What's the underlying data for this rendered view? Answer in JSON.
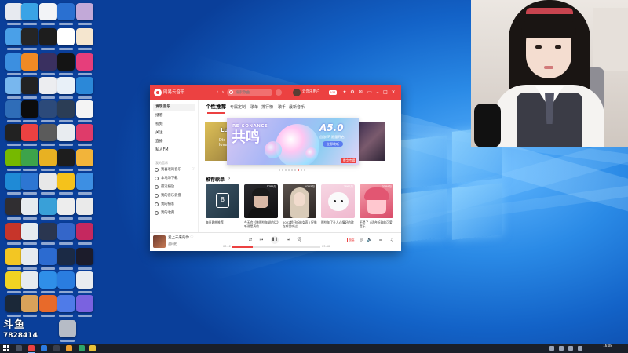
{
  "app": {
    "title": "网易云音乐",
    "search_placeholder": "搜索歌曲",
    "username": "云音乐用户",
    "vip_badge": "VIP",
    "tabs": [
      "个性推荐",
      "专属定制",
      "歌单",
      "排行榜",
      "歌手",
      "最新音乐"
    ],
    "sidebar": {
      "items": [
        "发现音乐",
        "播客",
        "视频",
        "关注",
        "直播",
        "私人FM"
      ],
      "section_label": "我的音乐",
      "sub_items": [
        "我喜欢的音乐",
        "本地与下载",
        "最近播放",
        "我的音乐云盘",
        "我的播客",
        "我的收藏"
      ]
    },
    "banner": {
      "left_title": "Lo",
      "left_sub": "Did you\nlove",
      "title": "RE-SONANCE",
      "cjk": "共鸣",
      "logo": "A5.0",
      "album_line": "首张EP 限量开启",
      "button": "立即收听",
      "tag": "数字专辑",
      "dot_count": 9,
      "active_dot": 6
    },
    "recommend": {
      "title": "推荐歌单",
      "arrow": "›",
      "cards": [
        {
          "title": "每日歌曲推荐",
          "count": "",
          "calendar_day": "8"
        },
        {
          "title": "今天会《她那些年说的话》听说是真的",
          "count": "1789万"
        },
        {
          "title": "2022超好听的女声 | 好像在哪里听过",
          "count": "4325万"
        },
        {
          "title": "那些年了让人心情好的歌",
          "count": "7862万"
        },
        {
          "title": "不是了 | 适合听歌的可爱音乐",
          "count": "3189万"
        }
      ]
    },
    "player": {
      "track_title": "爱上未来的你",
      "track_artist": "潘玮柏",
      "like_icon": "♡",
      "time_current": "00:12",
      "time_total": "03:46",
      "progress": 0.23,
      "quality": "极高"
    }
  },
  "watermark": {
    "brand": "斗鱼",
    "room": "7828414"
  },
  "taskbar": {
    "time": "16:08",
    "date": "2022/1/28"
  },
  "colors": {
    "accent": "#ec4141",
    "taskbar": "#1a1f29"
  }
}
